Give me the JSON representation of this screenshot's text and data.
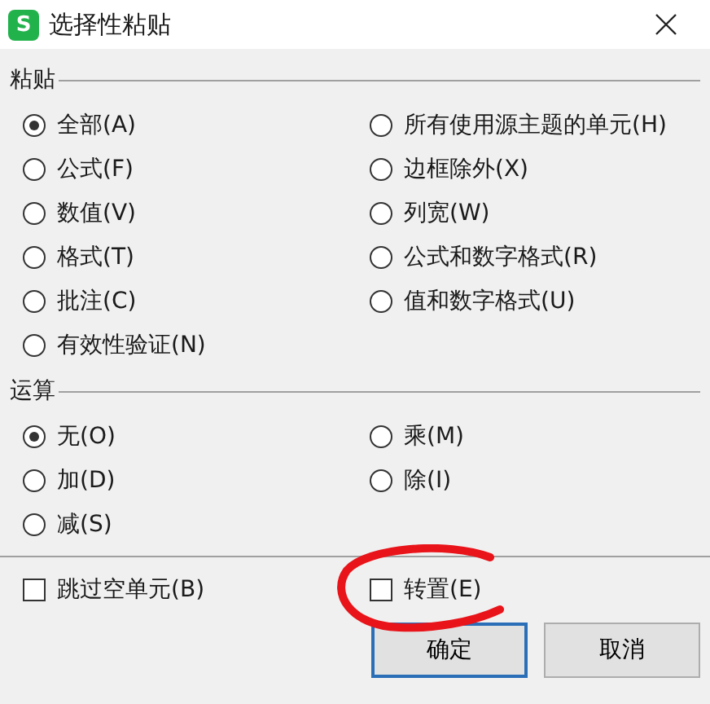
{
  "window": {
    "icon_text": "S",
    "title": "选择性粘贴"
  },
  "paste": {
    "label": "粘贴",
    "options": [
      {
        "label": "全部(A)",
        "selected": true
      },
      {
        "label": "所有使用源主题的单元(H)",
        "selected": false
      },
      {
        "label": "公式(F)",
        "selected": false
      },
      {
        "label": "边框除外(X)",
        "selected": false
      },
      {
        "label": "数值(V)",
        "selected": false
      },
      {
        "label": "列宽(W)",
        "selected": false
      },
      {
        "label": "格式(T)",
        "selected": false
      },
      {
        "label": "公式和数字格式(R)",
        "selected": false
      },
      {
        "label": "批注(C)",
        "selected": false
      },
      {
        "label": "值和数字格式(U)",
        "selected": false
      },
      {
        "label": "有效性验证(N)",
        "selected": false
      }
    ]
  },
  "operation": {
    "label": "运算",
    "options": [
      {
        "label": "无(O)",
        "selected": true
      },
      {
        "label": "乘(M)",
        "selected": false
      },
      {
        "label": "加(D)",
        "selected": false
      },
      {
        "label": "除(I)",
        "selected": false
      },
      {
        "label": "减(S)",
        "selected": false
      }
    ]
  },
  "checkboxes": [
    {
      "label": "跳过空单元(B)",
      "checked": false
    },
    {
      "label": "转置(E)",
      "checked": false,
      "annotated": true
    }
  ],
  "buttons": [
    {
      "label": "确定",
      "default": true
    },
    {
      "label": "取消",
      "default": false
    }
  ]
}
